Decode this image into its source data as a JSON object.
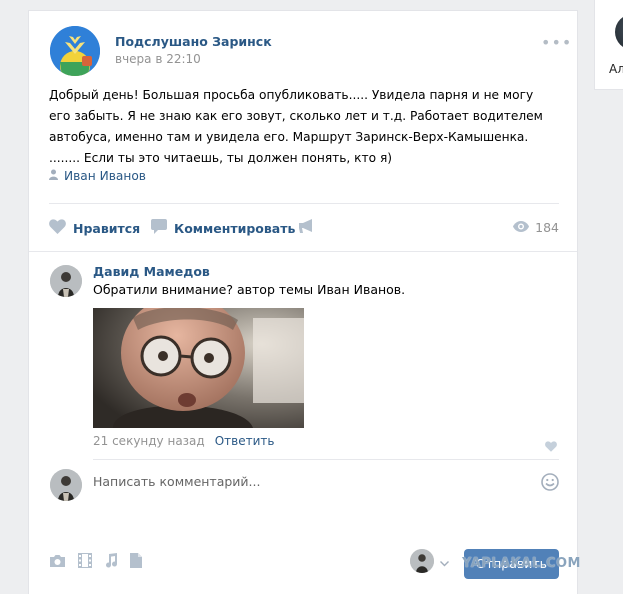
{
  "post": {
    "group_name": "Подслушано Заринск",
    "time": "вчера в 22:10",
    "text": "Добрый день! Большая просьба опубликовать..... Увидела парня и не могу его забыть. Я не знаю как его зовут, сколько лет и т.д. Работает водителем автобуса, именно там и увидела его. Маршрут Заринск-Верх-Камышенка. ........ Если ты это читаешь, ты должен понять, кто я)",
    "author": "Иван Иванов",
    "actions": {
      "like_label": "Нравится",
      "comment_label": "Комментировать",
      "views": "184"
    }
  },
  "comment": {
    "author": "Давид Мамедов",
    "text": "Обратили внимание? автор темы Иван Иванов.",
    "time": "21 секунду назад",
    "reply_label": "Ответить"
  },
  "new_comment": {
    "placeholder": "Написать комментарий...",
    "send_label": "Отправить"
  },
  "right_panel": {
    "name": "Ал"
  },
  "watermark": "YAPLAKAL.COM",
  "colors": {
    "link": "#2a5885",
    "accent": "#5181b8",
    "muted": "#939393",
    "background": "#edeef0"
  },
  "icons": [
    "dots-icon",
    "person-icon",
    "heart-icon",
    "comment-icon",
    "share-icon",
    "eye-icon",
    "smile-icon",
    "camera-icon",
    "video-icon",
    "music-icon",
    "doc-icon",
    "chevron-down-icon"
  ]
}
